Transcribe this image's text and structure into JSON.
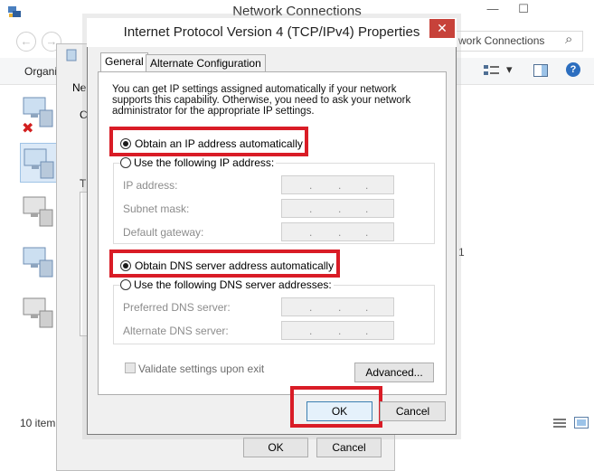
{
  "background_window": {
    "title": "Network Connections",
    "minimize_glyph": "—",
    "maximize_glyph": "☐",
    "search_text": "work Connections",
    "organize_label": "Organi",
    "status_text": "10 item",
    "partial_labels": {
      "ne": "Ne",
      "c": "C",
      "t": "T",
      "one": "1"
    },
    "back_glyph": "←",
    "forward_glyph": "→"
  },
  "middle_window": {
    "ok_label": "OK",
    "cancel_label": "Cancel"
  },
  "dialog": {
    "title": "Internet Protocol Version 4 (TCP/IPv4) Properties",
    "close_glyph": "✕",
    "tabs": [
      {
        "label": "General",
        "active": true
      },
      {
        "label": "Alternate Configuration",
        "active": false
      }
    ],
    "description": "You can get IP settings assigned automatically if your network supports this capability. Otherwise, you need to ask your network administrator for the appropriate IP settings.",
    "ip_section": {
      "auto_label": "Obtain an IP address automatically",
      "manual_label": "Use the following IP address:",
      "selected": "auto",
      "fields": [
        {
          "label": "IP address:",
          "value": ". . ."
        },
        {
          "label": "Subnet mask:",
          "value": ". . ."
        },
        {
          "label": "Default gateway:",
          "value": ". . ."
        }
      ]
    },
    "dns_section": {
      "auto_label": "Obtain DNS server address automatically",
      "manual_label": "Use the following DNS server addresses:",
      "selected": "auto",
      "fields": [
        {
          "label": "Preferred DNS server:",
          "value": ". . ."
        },
        {
          "label": "Alternate DNS server:",
          "value": ". . ."
        }
      ]
    },
    "validate_label": "Validate settings upon exit",
    "validate_checked": false,
    "advanced_label": "Advanced...",
    "ok_label": "OK",
    "cancel_label": "Cancel",
    "highlight_color": "#d91c26"
  },
  "icons": {
    "title_app_icon": "network-connections-icon",
    "x_mark": "✖",
    "search": "⌕",
    "dropdown": "▾",
    "help": "?"
  }
}
